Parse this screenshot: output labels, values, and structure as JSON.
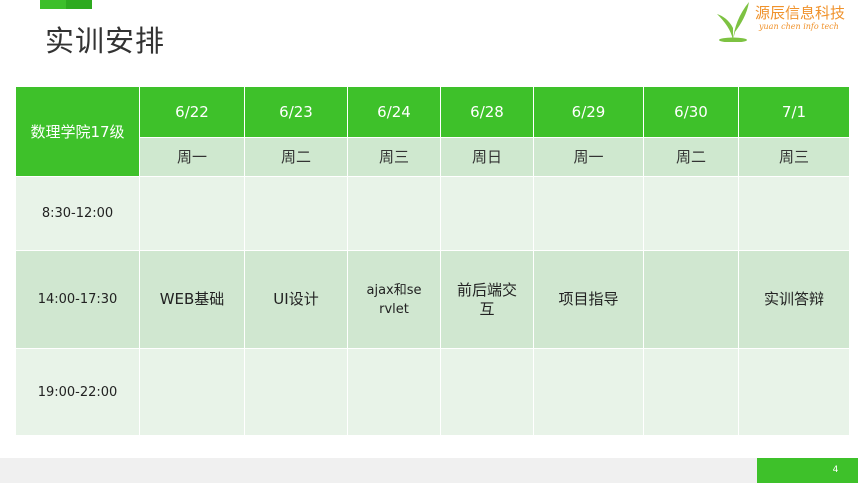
{
  "slide": {
    "title": "实训安排",
    "page_number": "4"
  },
  "logo": {
    "name": "源辰信息科技",
    "subtitle": "yuan chen info tech",
    "colors": {
      "leaf": "#7dc242",
      "text": "#f0922b"
    }
  },
  "colors": {
    "accent": "#3ec12a",
    "light_row": "#e8f3e8",
    "mid_row": "#d0e7d0"
  },
  "schedule": {
    "corner": "数理学院17级",
    "dates": [
      "6/22",
      "6/23",
      "6/24",
      "6/28",
      "6/29",
      "6/30",
      "7/1"
    ],
    "days": [
      "周一",
      "周二",
      "周三",
      "周日",
      "周一",
      "周二",
      "周三"
    ],
    "rows": [
      {
        "time": "8:30-12:00",
        "cells": [
          "",
          "",
          "",
          "",
          "",
          "",
          ""
        ]
      },
      {
        "time": "14:00-17:30",
        "cells": [
          "WEB基础",
          "UI设计",
          "ajax和servlet",
          "前后端交互",
          "项目指导",
          "",
          "实训答辩"
        ]
      },
      {
        "time": "19:00-22:00",
        "cells": [
          "",
          "",
          "",
          "",
          "",
          "",
          ""
        ]
      }
    ]
  }
}
